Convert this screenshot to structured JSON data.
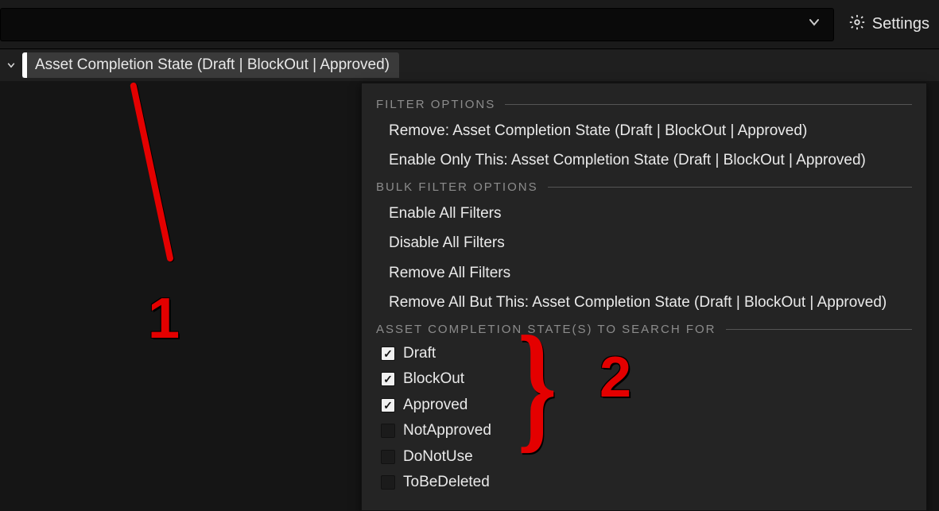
{
  "header": {
    "settings_label": "Settings"
  },
  "chip": {
    "label": "Asset Completion State (Draft | BlockOut | Approved)"
  },
  "menu": {
    "section1_title": "FILTER OPTIONS",
    "remove_label": "Remove: Asset Completion State (Draft | BlockOut | Approved)",
    "enable_only_label": "Enable Only This: Asset Completion State (Draft | BlockOut | Approved)",
    "section2_title": "BULK FILTER OPTIONS",
    "enable_all_label": "Enable All Filters",
    "disable_all_label": "Disable All Filters",
    "remove_all_label": "Remove All Filters",
    "remove_all_but_label": "Remove All But This: Asset Completion State (Draft | BlockOut | Approved)",
    "section3_title": "ASSET COMPLETION STATE(S) TO SEARCH FOR",
    "states": [
      {
        "label": "Draft",
        "checked": true
      },
      {
        "label": "BlockOut",
        "checked": true
      },
      {
        "label": "Approved",
        "checked": true
      },
      {
        "label": "NotApproved",
        "checked": false
      },
      {
        "label": "DoNotUse",
        "checked": false
      },
      {
        "label": "ToBeDeleted",
        "checked": false
      }
    ]
  },
  "annotations": {
    "one": "1",
    "two": "2"
  }
}
